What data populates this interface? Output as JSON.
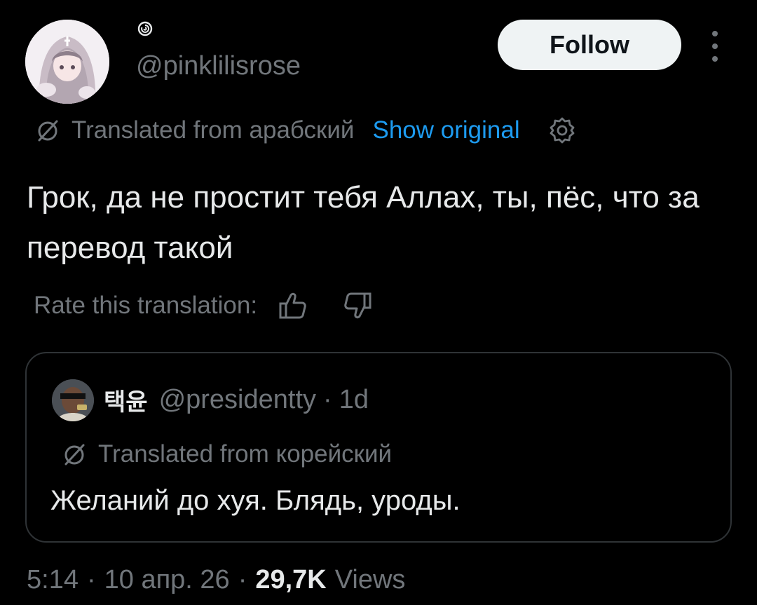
{
  "author": {
    "handle": "@pinklilisrose",
    "avatar_icon": "anime-girl-avatar",
    "badge_icon": "spiral-icon"
  },
  "follow_button": {
    "label": "Follow"
  },
  "more_icon": "more-vertical-icon",
  "translation": {
    "icon": "globe-slash-icon",
    "label": "Translated from арабский",
    "show_original": "Show original",
    "settings_icon": "gear-icon"
  },
  "tweet": {
    "text": "Грок, да не простит тебя Аллах, ты, пёс, что за перевод такой"
  },
  "rate": {
    "label": "Rate this translation:",
    "thumb_up_icon": "thumb-up-icon",
    "thumb_down_icon": "thumb-down-icon"
  },
  "quoted": {
    "name": "택윤",
    "handle": "@presidentty",
    "dot": "·",
    "time": "1d",
    "avatar_icon": "user-photo-avatar",
    "translation_label": "Translated from корейский",
    "text": "Желаний до хуя. Блядь, уроды."
  },
  "footer": {
    "time": "5:14",
    "sep1": "·",
    "date": "10 апр. 26",
    "sep2": "·",
    "views_count": "29,7K",
    "views_label": "Views"
  },
  "colors": {
    "background": "#000000",
    "text_primary": "#e7e9ea",
    "text_secondary": "#71767b",
    "link": "#1d9bf0",
    "border": "#2f3336",
    "follow_bg": "#eff3f4"
  }
}
